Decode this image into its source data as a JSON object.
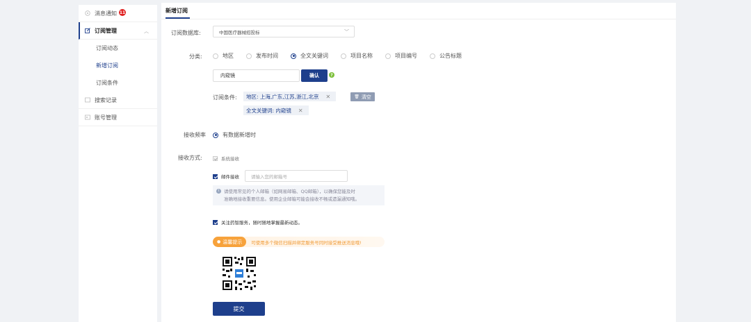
{
  "sidebar": {
    "notifications": {
      "label": "消息通知",
      "badge": "11",
      "icon": "bell-icon"
    },
    "subscription": {
      "label": "订阅管理",
      "icon": "edit-icon",
      "children": [
        {
          "label": "订阅动态"
        },
        {
          "label": "新增订阅"
        },
        {
          "label": "订阅条件"
        }
      ]
    },
    "search_history": {
      "label": "搜索记录",
      "icon": "list-icon"
    },
    "account": {
      "label": "账号管理",
      "icon": "user-icon"
    }
  },
  "main": {
    "tab": "新增订阅",
    "database": {
      "label": "订阅数据库:",
      "value": "中国医疗器械招投标"
    },
    "category": {
      "label": "分类:",
      "options": [
        "地区",
        "发布时间",
        "全文关键词",
        "项目名称",
        "项目编号",
        "公告标题"
      ],
      "selected": "全文关键词"
    },
    "keyword": {
      "value": "内窥镜",
      "confirm": "确认",
      "help": "?"
    },
    "conditions": {
      "label": "订阅条件:",
      "tags": [
        "地区: 上海,广东,江苏,浙江,北京",
        "全文关键词: 内窥镜"
      ],
      "clear": "清空"
    },
    "frequency": {
      "label": "接收频率",
      "value": "有数据新增时"
    },
    "method": {
      "label": "接收方式:",
      "system": "系统接收",
      "email": "邮件接收",
      "email_placeholder": "请输入您的邮箱号",
      "info_line1": "请使用常见的个人邮箱（如网易邮箱、QQ邮箱），以确保您能及时",
      "info_line2": "准确地接收重要信息。使用企业邮箱可能会接收不畅或遗漏通知哦。"
    },
    "follow": "关注药智服务，随时随地掌握最新动态。",
    "tip": {
      "badge": "温馨提示",
      "text": "可使用多个微信扫描并绑定服务号同时接受推送消息哦!"
    },
    "submit": "提交"
  },
  "colors": {
    "primary": "#1e3f8c",
    "badge": "#e02020",
    "tip": "#f7a23b"
  }
}
